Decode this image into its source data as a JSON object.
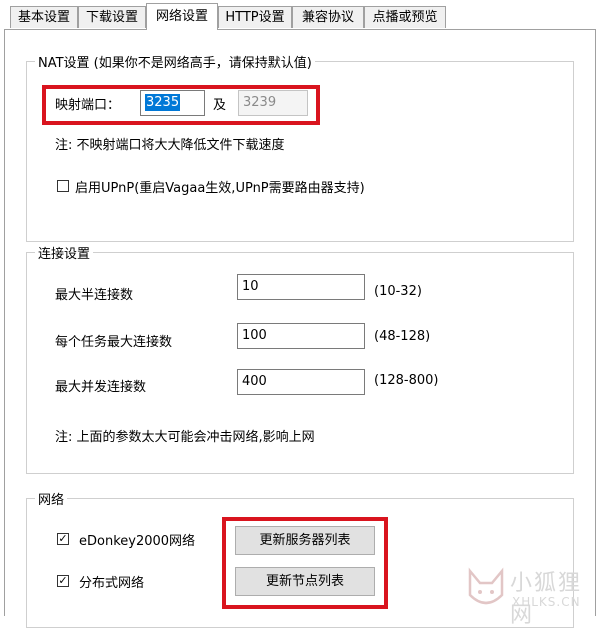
{
  "tabs": [
    {
      "label": "基本设置",
      "active": false
    },
    {
      "label": "下载设置",
      "active": false
    },
    {
      "label": "网络设置",
      "active": true
    },
    {
      "label": "HTTP设置",
      "active": false
    },
    {
      "label": "兼容协议",
      "active": false
    },
    {
      "label": "点播或预览",
      "active": false
    }
  ],
  "nat": {
    "legend": "NAT设置 (如果你不是网络高手，请保持默认值)",
    "port_label": "映射端口：",
    "port_value": "3235",
    "and_label": "及",
    "port2_value": "3239",
    "note": "注: 不映射端口将大大降低文件下载速度",
    "upnp_label": "启用UPnP(重启Vagaa生效,UPnP需要路由器支持)",
    "upnp_checked": false
  },
  "conn": {
    "legend": "连接设置",
    "rows": [
      {
        "label": "最大半连接数",
        "value": "10",
        "range": "(10-32)"
      },
      {
        "label": "每个任务最大连接数",
        "value": "100",
        "range": "(48-128)"
      },
      {
        "label": "最大并发连接数",
        "value": "400",
        "range": "(128-800)"
      }
    ],
    "note": "注: 上面的参数太大可能会冲击网络,影响上网"
  },
  "network": {
    "legend": "网络",
    "edonkey_label": "eDonkey2000网络",
    "edonkey_checked": true,
    "distributed_label": "分布式网络",
    "distributed_checked": true,
    "update_servers_label": "更新服务器列表",
    "update_nodes_label": "更新节点列表"
  },
  "watermark": {
    "text1": "小狐狸网",
    "text2": "XHLKS.CN"
  },
  "colors": {
    "highlight": "#d9141e",
    "selection": "#0078d7"
  }
}
